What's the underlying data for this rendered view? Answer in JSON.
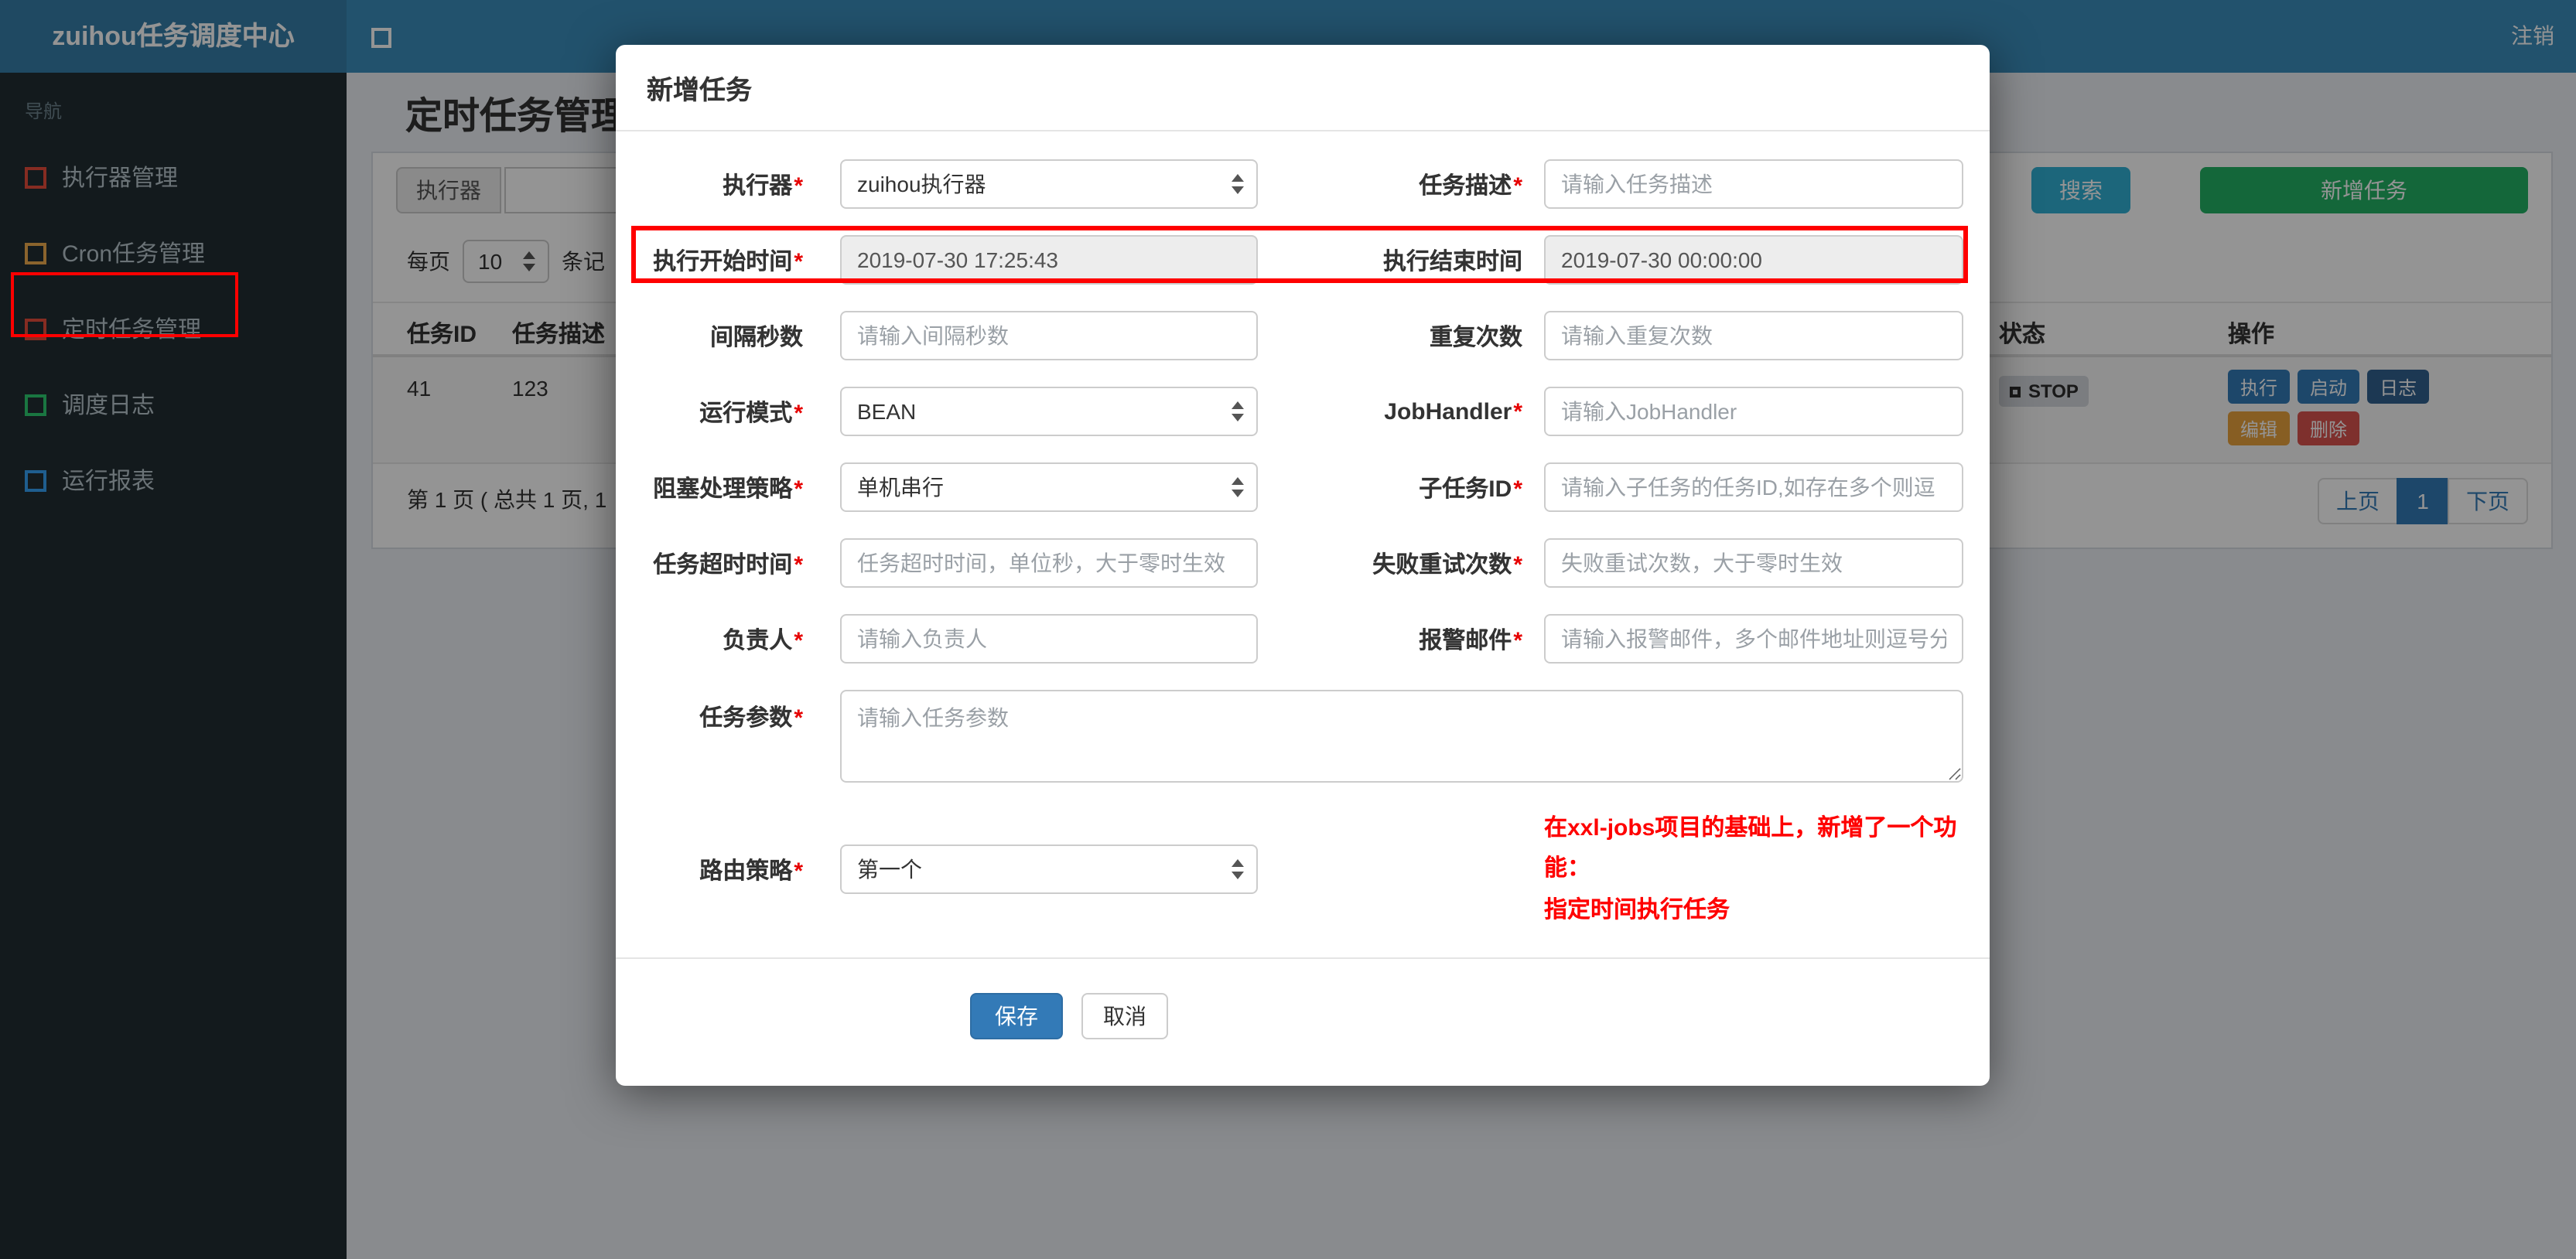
{
  "colors": {
    "navbar": "#3c8dbc",
    "logo_area": "#367fa9",
    "sidebar": "#222d32",
    "primary_blue": "#337ab7",
    "search_teal": "#31b0d5",
    "add_green": "#23b164",
    "edit_orange": "#e8a33d",
    "delete_red": "#d9534f",
    "annotation_red": "#ff0000"
  },
  "header": {
    "brand": "zuihou任务调度中心",
    "logout_label": "注销"
  },
  "sidebar": {
    "section_label": "导航",
    "items": [
      {
        "label": "执行器管理",
        "icon": "square-icon",
        "icon_color": "#e74c3c"
      },
      {
        "label": "Cron任务管理",
        "icon": "square-icon",
        "icon_color": "#f0ad4e"
      },
      {
        "label": "定时任务管理",
        "icon": "square-icon",
        "icon_color": "#e74c3c",
        "annotated": true
      },
      {
        "label": "调度日志",
        "icon": "square-icon",
        "icon_color": "#2ecc71"
      },
      {
        "label": "运行报表",
        "icon": "square-icon",
        "icon_color": "#36a3f7"
      }
    ]
  },
  "page": {
    "title": "定时任务管理",
    "filter": {
      "executor_addon": "执行器",
      "search_button": "搜索",
      "add_button": "新增任务"
    },
    "per_page": {
      "prefix": "每页",
      "value": "10",
      "suffix": "条记"
    },
    "table": {
      "headers": {
        "job_id": "任务ID",
        "job_desc": "任务描述",
        "status": "状态",
        "ops": "操作"
      },
      "row": {
        "job_id": "41",
        "job_desc": "123",
        "status": "STOP",
        "actions": {
          "run": "执行",
          "start": "启动",
          "log": "日志",
          "edit": "编辑",
          "delete": "删除"
        }
      }
    },
    "pagination": {
      "summary": "第 1 页 ( 总共 1 页, 1",
      "prev": "上页",
      "current": "1",
      "next": "下页"
    }
  },
  "modal": {
    "title": "新增任务",
    "fields": {
      "executor": {
        "label": "执行器",
        "star": "*",
        "value": "zuihou执行器"
      },
      "job_desc": {
        "label": "任务描述",
        "star": "*",
        "placeholder": "请输入任务描述"
      },
      "start_time": {
        "label": "执行开始时间",
        "star": "*",
        "value": "2019-07-30 17:25:43"
      },
      "end_time": {
        "label": "执行结束时间",
        "value": "2019-07-30 00:00:00"
      },
      "interval": {
        "label": "间隔秒数",
        "placeholder": "请输入间隔秒数"
      },
      "repeat_count": {
        "label": "重复次数",
        "placeholder": "请输入重复次数"
      },
      "run_mode": {
        "label": "运行模式",
        "star": "*",
        "value": "BEAN"
      },
      "job_handler": {
        "label": "JobHandler",
        "star": "*",
        "placeholder": "请输入JobHandler"
      },
      "block_strategy": {
        "label": "阻塞处理策略",
        "star": "*",
        "value": "单机串行"
      },
      "child_job_id": {
        "label": "子任务ID",
        "star": "*",
        "placeholder": "请输入子任务的任务ID,如存在多个则逗"
      },
      "timeout": {
        "label": "任务超时时间",
        "star": "*",
        "placeholder": "任务超时时间，单位秒，大于零时生效"
      },
      "fail_retry": {
        "label": "失败重试次数",
        "star": "*",
        "placeholder": "失败重试次数，大于零时生效"
      },
      "owner": {
        "label": "负责人",
        "star": "*",
        "placeholder": "请输入负责人"
      },
      "alarm_email": {
        "label": "报警邮件",
        "star": "*",
        "placeholder": "请输入报警邮件，多个邮件地址则逗号分"
      },
      "job_param": {
        "label": "任务参数",
        "star": "*",
        "placeholder": "请输入任务参数"
      },
      "route_strategy": {
        "label": "路由策略",
        "star": "*",
        "value": "第一个"
      }
    },
    "note": {
      "line1": "在xxl-jobs项目的基础上，新增了一个功能：",
      "line2": "指定时间执行任务"
    },
    "save_button": "保存",
    "cancel_button": "取消"
  }
}
